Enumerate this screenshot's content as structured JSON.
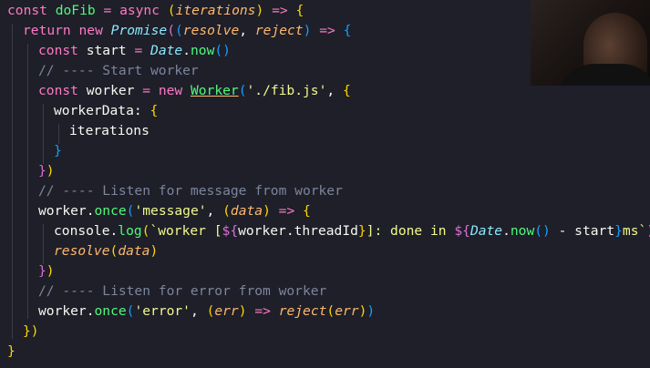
{
  "editor": {
    "language": "javascript",
    "theme_background": "#1e1f29",
    "lines": [
      "const doFib = async (iterations) => {",
      "return new Promise((resolve, reject) => {",
      "const start = Date.now()",
      "// ---- Start worker",
      "const worker = new Worker('./fib.js', {",
      "workerData: {",
      "iterations",
      "}",
      "})",
      "// ---- Listen for message from worker",
      "worker.once('message', (data) => {",
      "console.log(`worker [${worker.threadId}]: done in ${Date.now() - start}ms`)",
      "resolve(data)",
      "})",
      "// ---- Listen for error from worker",
      "worker.once('error', (err) => reject(err))",
      "})",
      "}"
    ]
  },
  "overlays": {
    "mouse_cursor_icon": "i-beam-cursor-icon",
    "webcam": "webcam-feed"
  },
  "colors": {
    "keyword": "#ff79c6",
    "function": "#50fa7b",
    "string": "#f1fa8c",
    "class": "#8be9fd",
    "parameter": "#ffb86c",
    "comment": "#7d859c",
    "bracket_level_1": "#ffd700",
    "bracket_level_2": "#da70d6",
    "bracket_level_3": "#179fff"
  }
}
